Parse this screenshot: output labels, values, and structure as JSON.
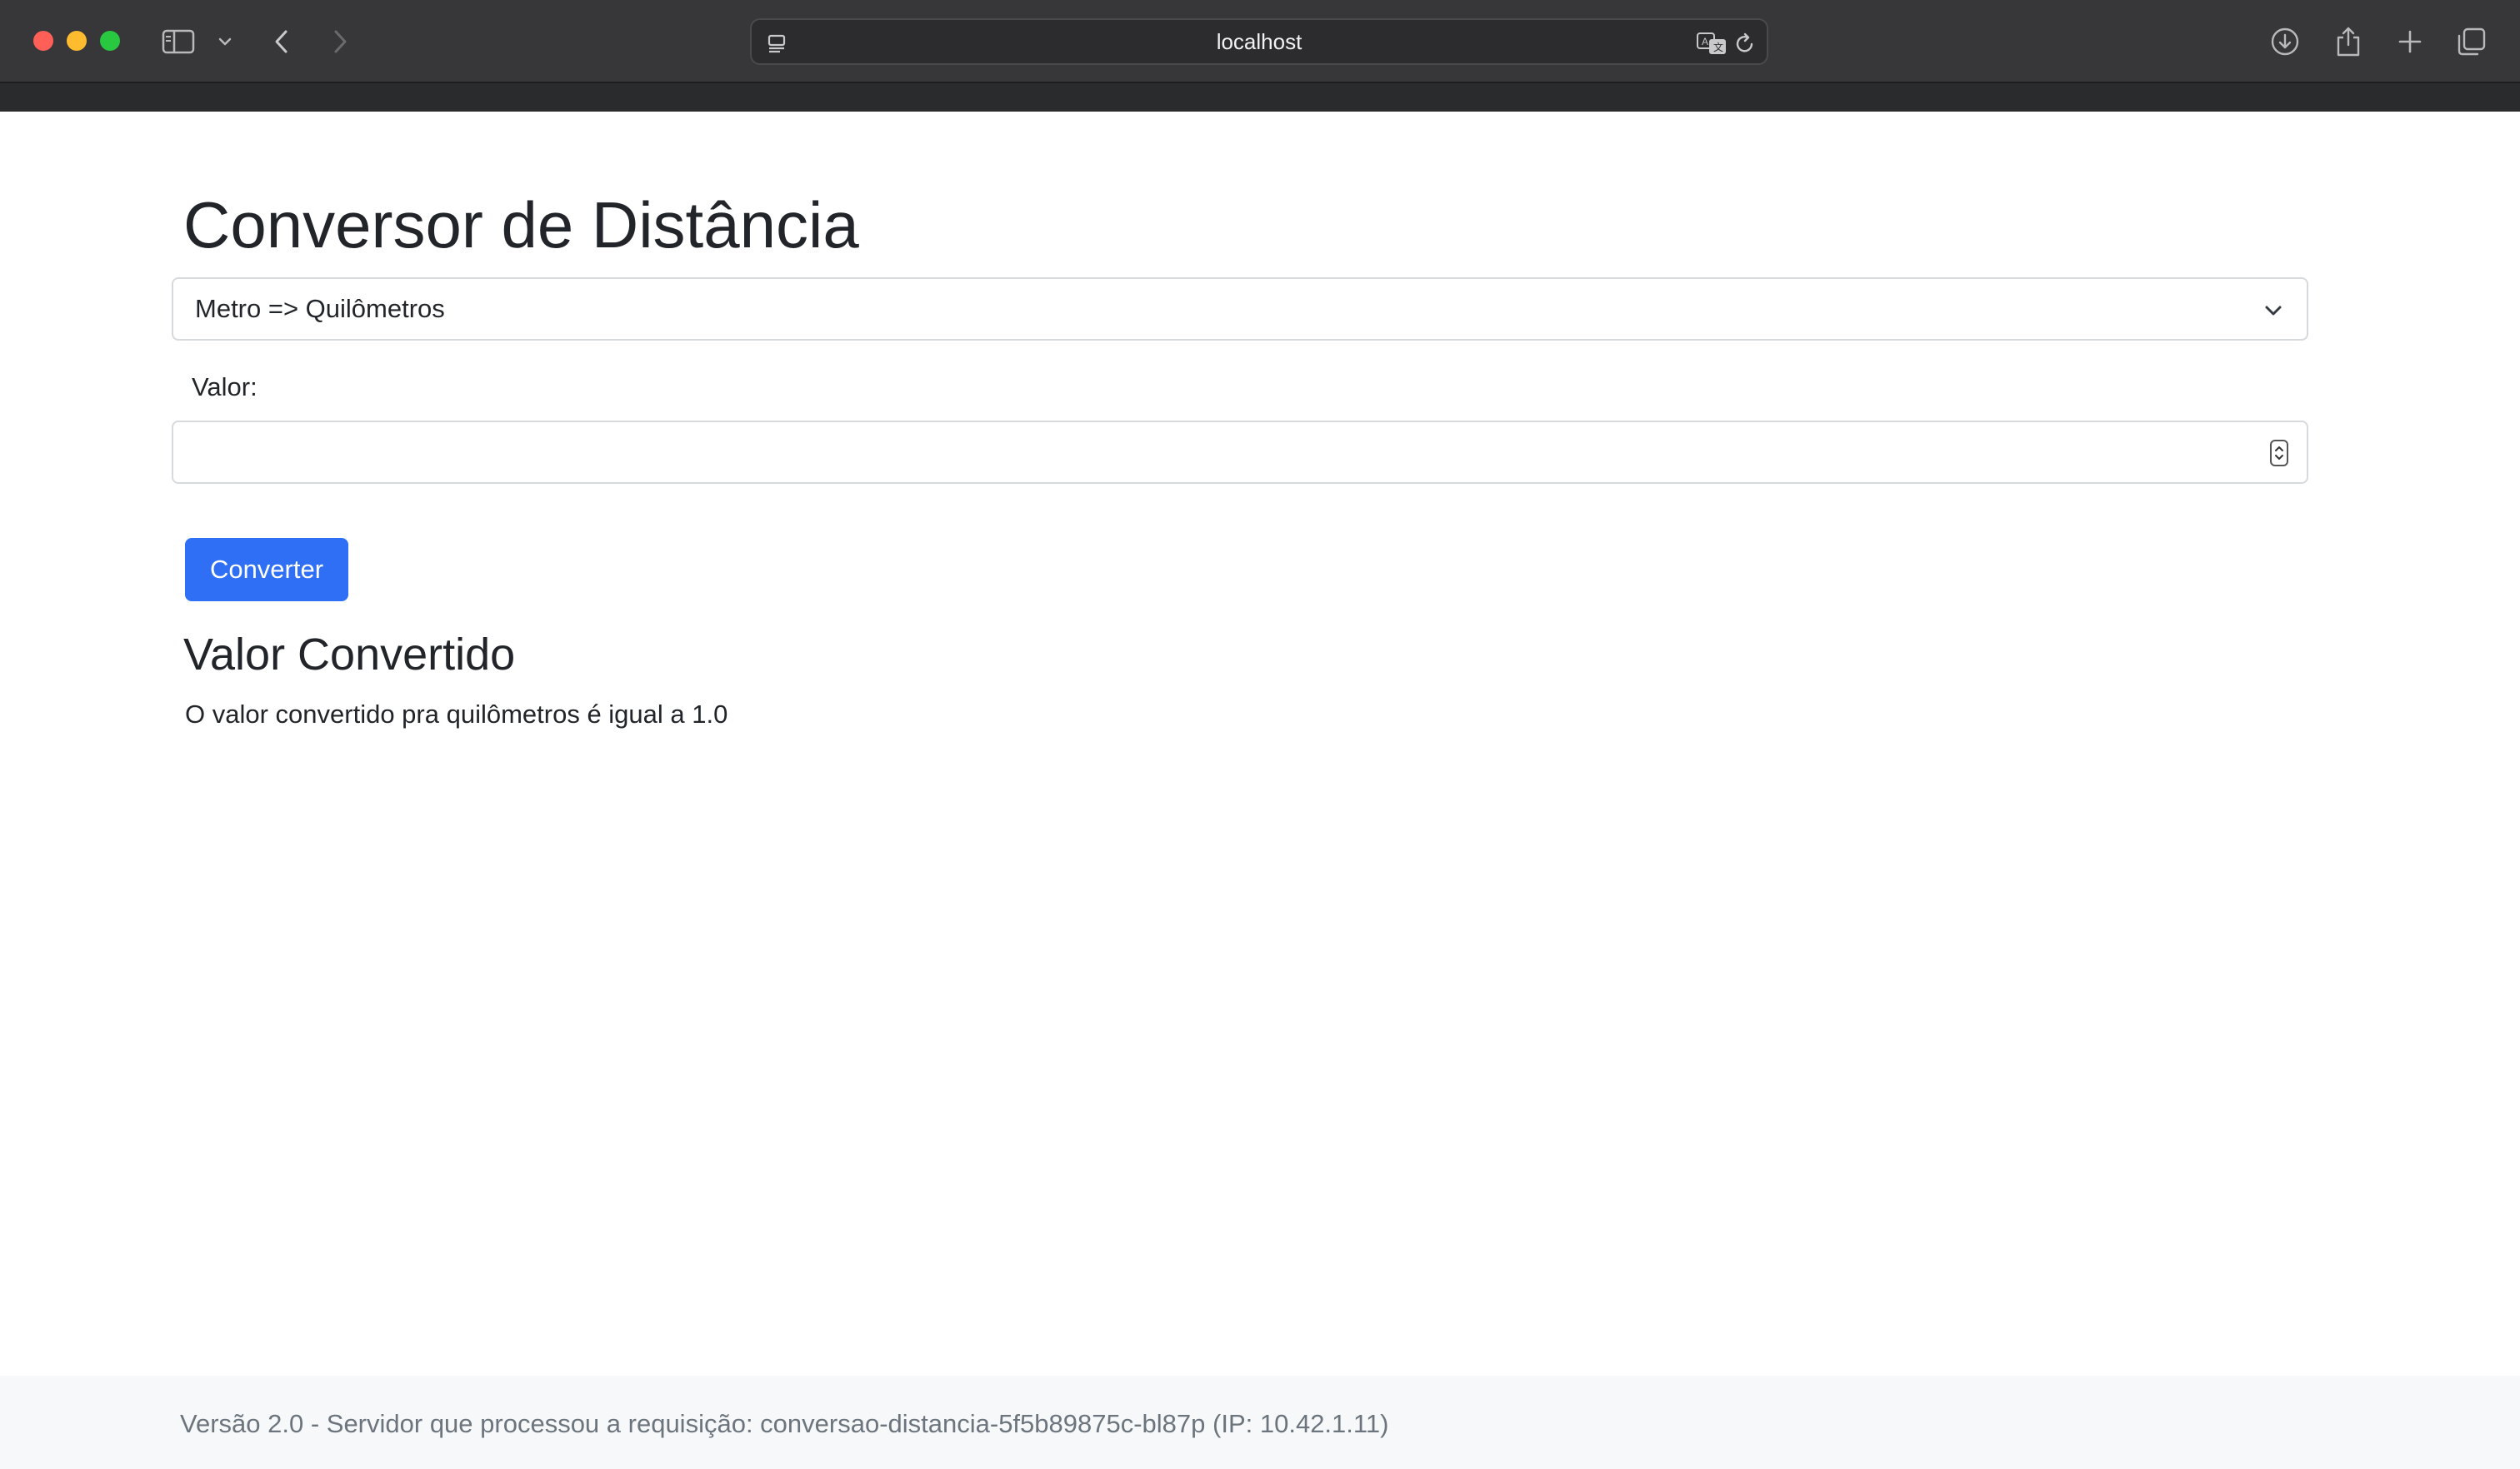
{
  "browser": {
    "url": "localhost"
  },
  "page": {
    "title": "Conversor de Distância",
    "conversion_select": {
      "selected": "Metro => Quilômetros"
    },
    "value_field": {
      "label": "Valor:",
      "value": ""
    },
    "convert_button": "Converter",
    "result_heading": "Valor Convertido",
    "result_text": "O valor convertido pra quilômetros é igual a 1.0"
  },
  "footer": {
    "text": "Versão 2.0 - Servidor que processou a requisição: conversao-distancia-5f5b89875c-bl87p (IP: 10.42.1.11)"
  },
  "colors": {
    "toolbar_bg": "#373739",
    "primary_button": "#2f6ff5",
    "text": "#212529",
    "footer_text": "#6c757d"
  },
  "icons": [
    "sidebar-icon",
    "chevron-down-icon",
    "back-arrow-icon",
    "forward-arrow-icon",
    "page-menu-icon",
    "translate-icon",
    "reload-icon",
    "download-icon",
    "share-icon",
    "new-tab-icon",
    "tab-overview-icon"
  ]
}
